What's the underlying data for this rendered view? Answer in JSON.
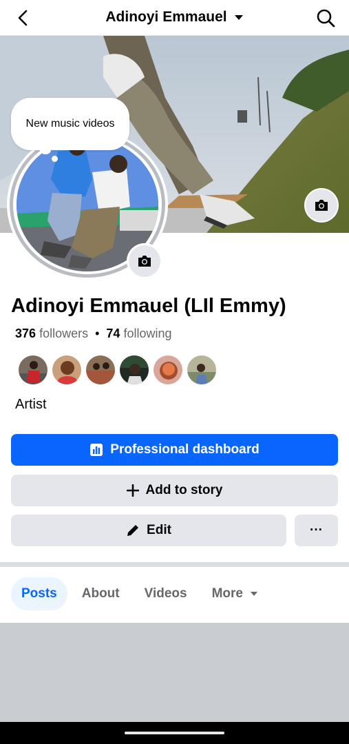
{
  "header": {
    "title": "Adinoyi Emmauel",
    "back_icon": "chevron-left-icon",
    "dropdown_icon": "caret-down-icon",
    "search_icon": "search-icon"
  },
  "cover": {
    "camera_icon": "camera-icon"
  },
  "note": {
    "text": "New music videos"
  },
  "profile": {
    "name": "Adinoyi Emmauel (LIl Emmy)",
    "followers_count": "376",
    "followers_label": "followers",
    "separator": "•",
    "following_count": "74",
    "following_label": "following",
    "bio": "Artist",
    "friend_avatars_count": 6
  },
  "buttons": {
    "professional_dashboard": "Professional dashboard",
    "add_to_story": "Add to story",
    "edit": "Edit",
    "more": "···"
  },
  "tabs": [
    {
      "label": "Posts",
      "active": true
    },
    {
      "label": "About",
      "active": false
    },
    {
      "label": "Videos",
      "active": false
    },
    {
      "label": "More",
      "active": false
    }
  ],
  "colors": {
    "accent": "#0866ff",
    "secondary_button": "#e4e6eb",
    "active_tab_bg": "#ebf5ff",
    "muted_text": "#65676b"
  }
}
